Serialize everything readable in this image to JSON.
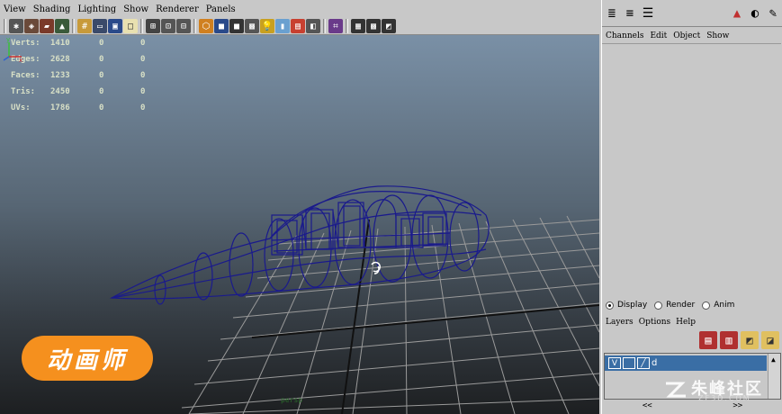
{
  "viewport": {
    "menu": [
      "View",
      "Shading",
      "Lighting",
      "Show",
      "Renderer",
      "Panels"
    ],
    "hud": [
      {
        "label": "Verts:",
        "v1": "1410",
        "v2": "0",
        "v3": "0"
      },
      {
        "label": "Edges:",
        "v1": "2628",
        "v2": "0",
        "v3": "0"
      },
      {
        "label": "Faces:",
        "v1": "1233",
        "v2": "0",
        "v3": "0"
      },
      {
        "label": "Tris:",
        "v1": "2450",
        "v2": "0",
        "v3": "0"
      },
      {
        "label": "UVs:",
        "v1": "1786",
        "v2": "0",
        "v3": "0"
      }
    ],
    "camera_label": "persp",
    "logo_text": "动画师"
  },
  "side_panel": {
    "channels_menu": [
      "Channels",
      "Edit",
      "Object",
      "Show"
    ],
    "layer_tabs": [
      "Display",
      "Render",
      "Anim"
    ],
    "selected_tab": "Display",
    "layers_menu": [
      "Layers",
      "Options",
      "Help"
    ],
    "layer": {
      "visibility": "V",
      "name": "d"
    },
    "nav_left": "<<",
    "nav_right": ">>"
  },
  "watermark": {
    "brand": "朱峰社区",
    "site": "ZF3D.COM"
  },
  "colors": {
    "wireframe": "#1a1a8c",
    "grid": "#9a9a9a",
    "logo": "#f5901e",
    "layer_selected": "#3a6ea5"
  }
}
